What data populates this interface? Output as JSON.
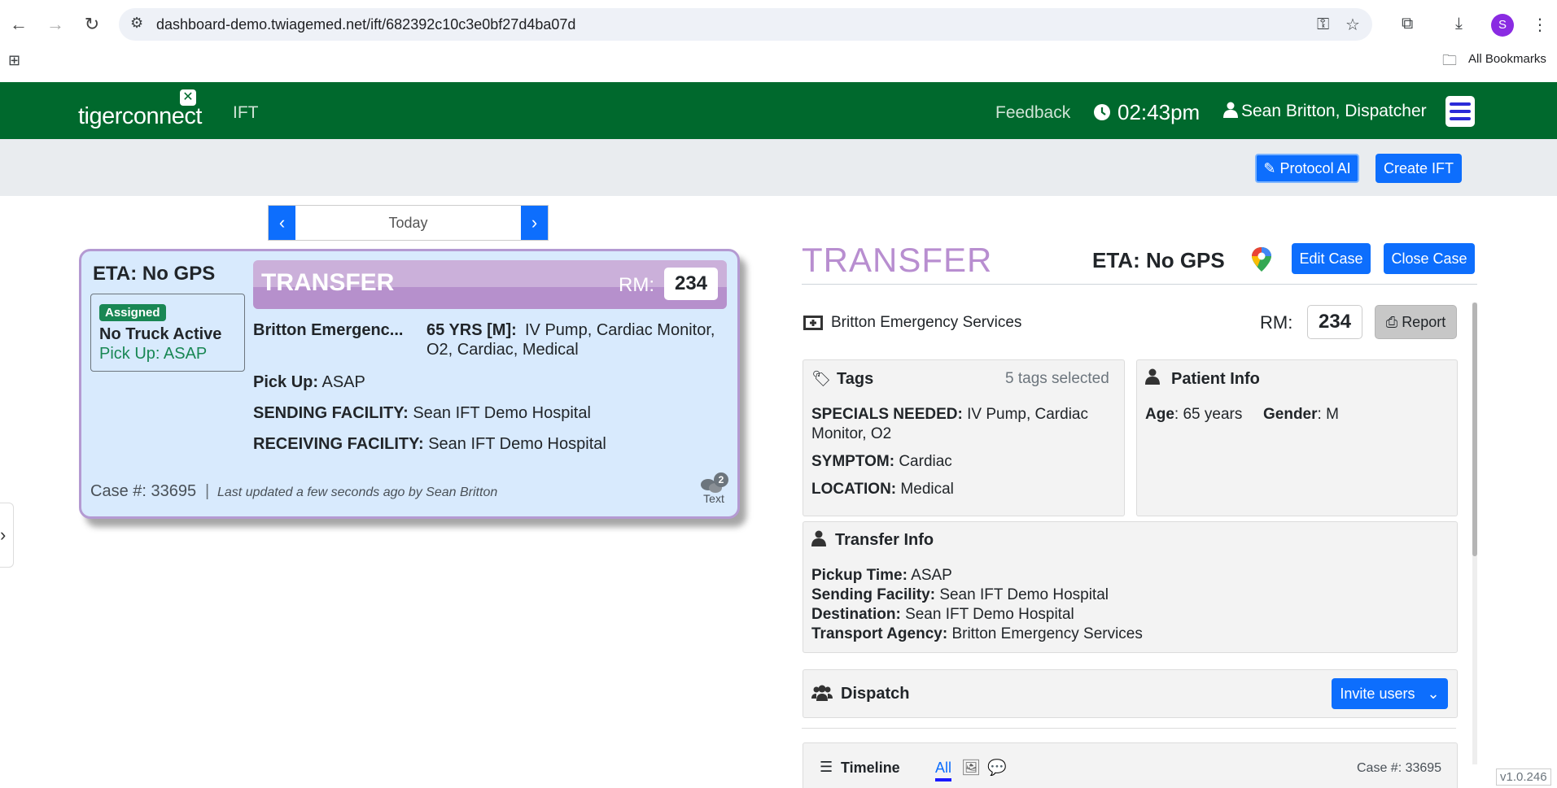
{
  "browser": {
    "url": "dashboard-demo.twiagemed.net/ift/682392c10c3e0bf27d4ba07d",
    "avatar_letter": "S",
    "bookmarks_label": "All Bookmarks"
  },
  "header": {
    "logo_text": "tigerconnect",
    "module": "IFT",
    "feedback": "Feedback",
    "time": "02:43pm",
    "user": "Sean Britton, Dispatcher",
    "brand_color": "#00692d"
  },
  "toolbar": {
    "protocol_ai": "Protocol AI",
    "create_ift": "Create IFT"
  },
  "date_nav": {
    "label": "Today"
  },
  "card": {
    "eta": "ETA: No GPS",
    "status_badge": "Assigned",
    "truck": "No Truck Active",
    "pickup_short": "Pick Up: ASAP",
    "title": "TRANSFER",
    "rm_label": "RM:",
    "rm_value": "234",
    "agency": "Britton Emergenc...",
    "patient": "65 YRS [M]:",
    "specials": "IV Pump, Cardiac Monitor,",
    "specials2": "O2, Cardiac, Medical",
    "pickup_label": "Pick Up:",
    "pickup_value": "ASAP",
    "sending_label": "SENDING FACILITY:",
    "sending_value": "Sean IFT Demo Hospital",
    "receiving_label": "RECEIVING FACILITY:",
    "receiving_value": "Sean IFT Demo Hospital",
    "case_label": "Case #: 33695",
    "updated": "Last updated a few seconds ago by Sean Britton",
    "chat_count": "2",
    "chat_label": "Text"
  },
  "detail": {
    "title": "TRANSFER",
    "eta": "ETA: No GPS",
    "edit_case": "Edit Case",
    "close_case": "Close Case",
    "agency": "Britton Emergency Services",
    "rm_label": "RM:",
    "rm_value": "234",
    "report": "Report",
    "tags": {
      "header": "Tags",
      "count": "5 tags selected",
      "specials_label": "SPECIALS NEEDED:",
      "specials_value": "IV Pump, Cardiac",
      "specials_value2": "Monitor, O2",
      "symptom_label": "SYMPTOM:",
      "symptom_value": "Cardiac",
      "location_label": "LOCATION:",
      "location_value": "Medical"
    },
    "patient": {
      "header": "Patient Info",
      "age_label": "Age",
      "age_value": ": 65 years",
      "gender_label": "Gender",
      "gender_value": ": M"
    },
    "transfer": {
      "header": "Transfer Info",
      "pickup_label": "Pickup Time:",
      "pickup_value": "ASAP",
      "sending_label": "Sending Facility:",
      "sending_value": "Sean IFT Demo Hospital",
      "dest_label": "Destination:",
      "dest_value": "Sean IFT Demo Hospital",
      "agency_label": "Transport Agency:",
      "agency_value": "Britton Emergency Services"
    },
    "dispatch": {
      "header": "Dispatch",
      "invite": "Invite users"
    },
    "timeline": {
      "header": "Timeline",
      "filter_all": "All",
      "case": "Case #: 33695"
    }
  },
  "version": "v1.0.246"
}
